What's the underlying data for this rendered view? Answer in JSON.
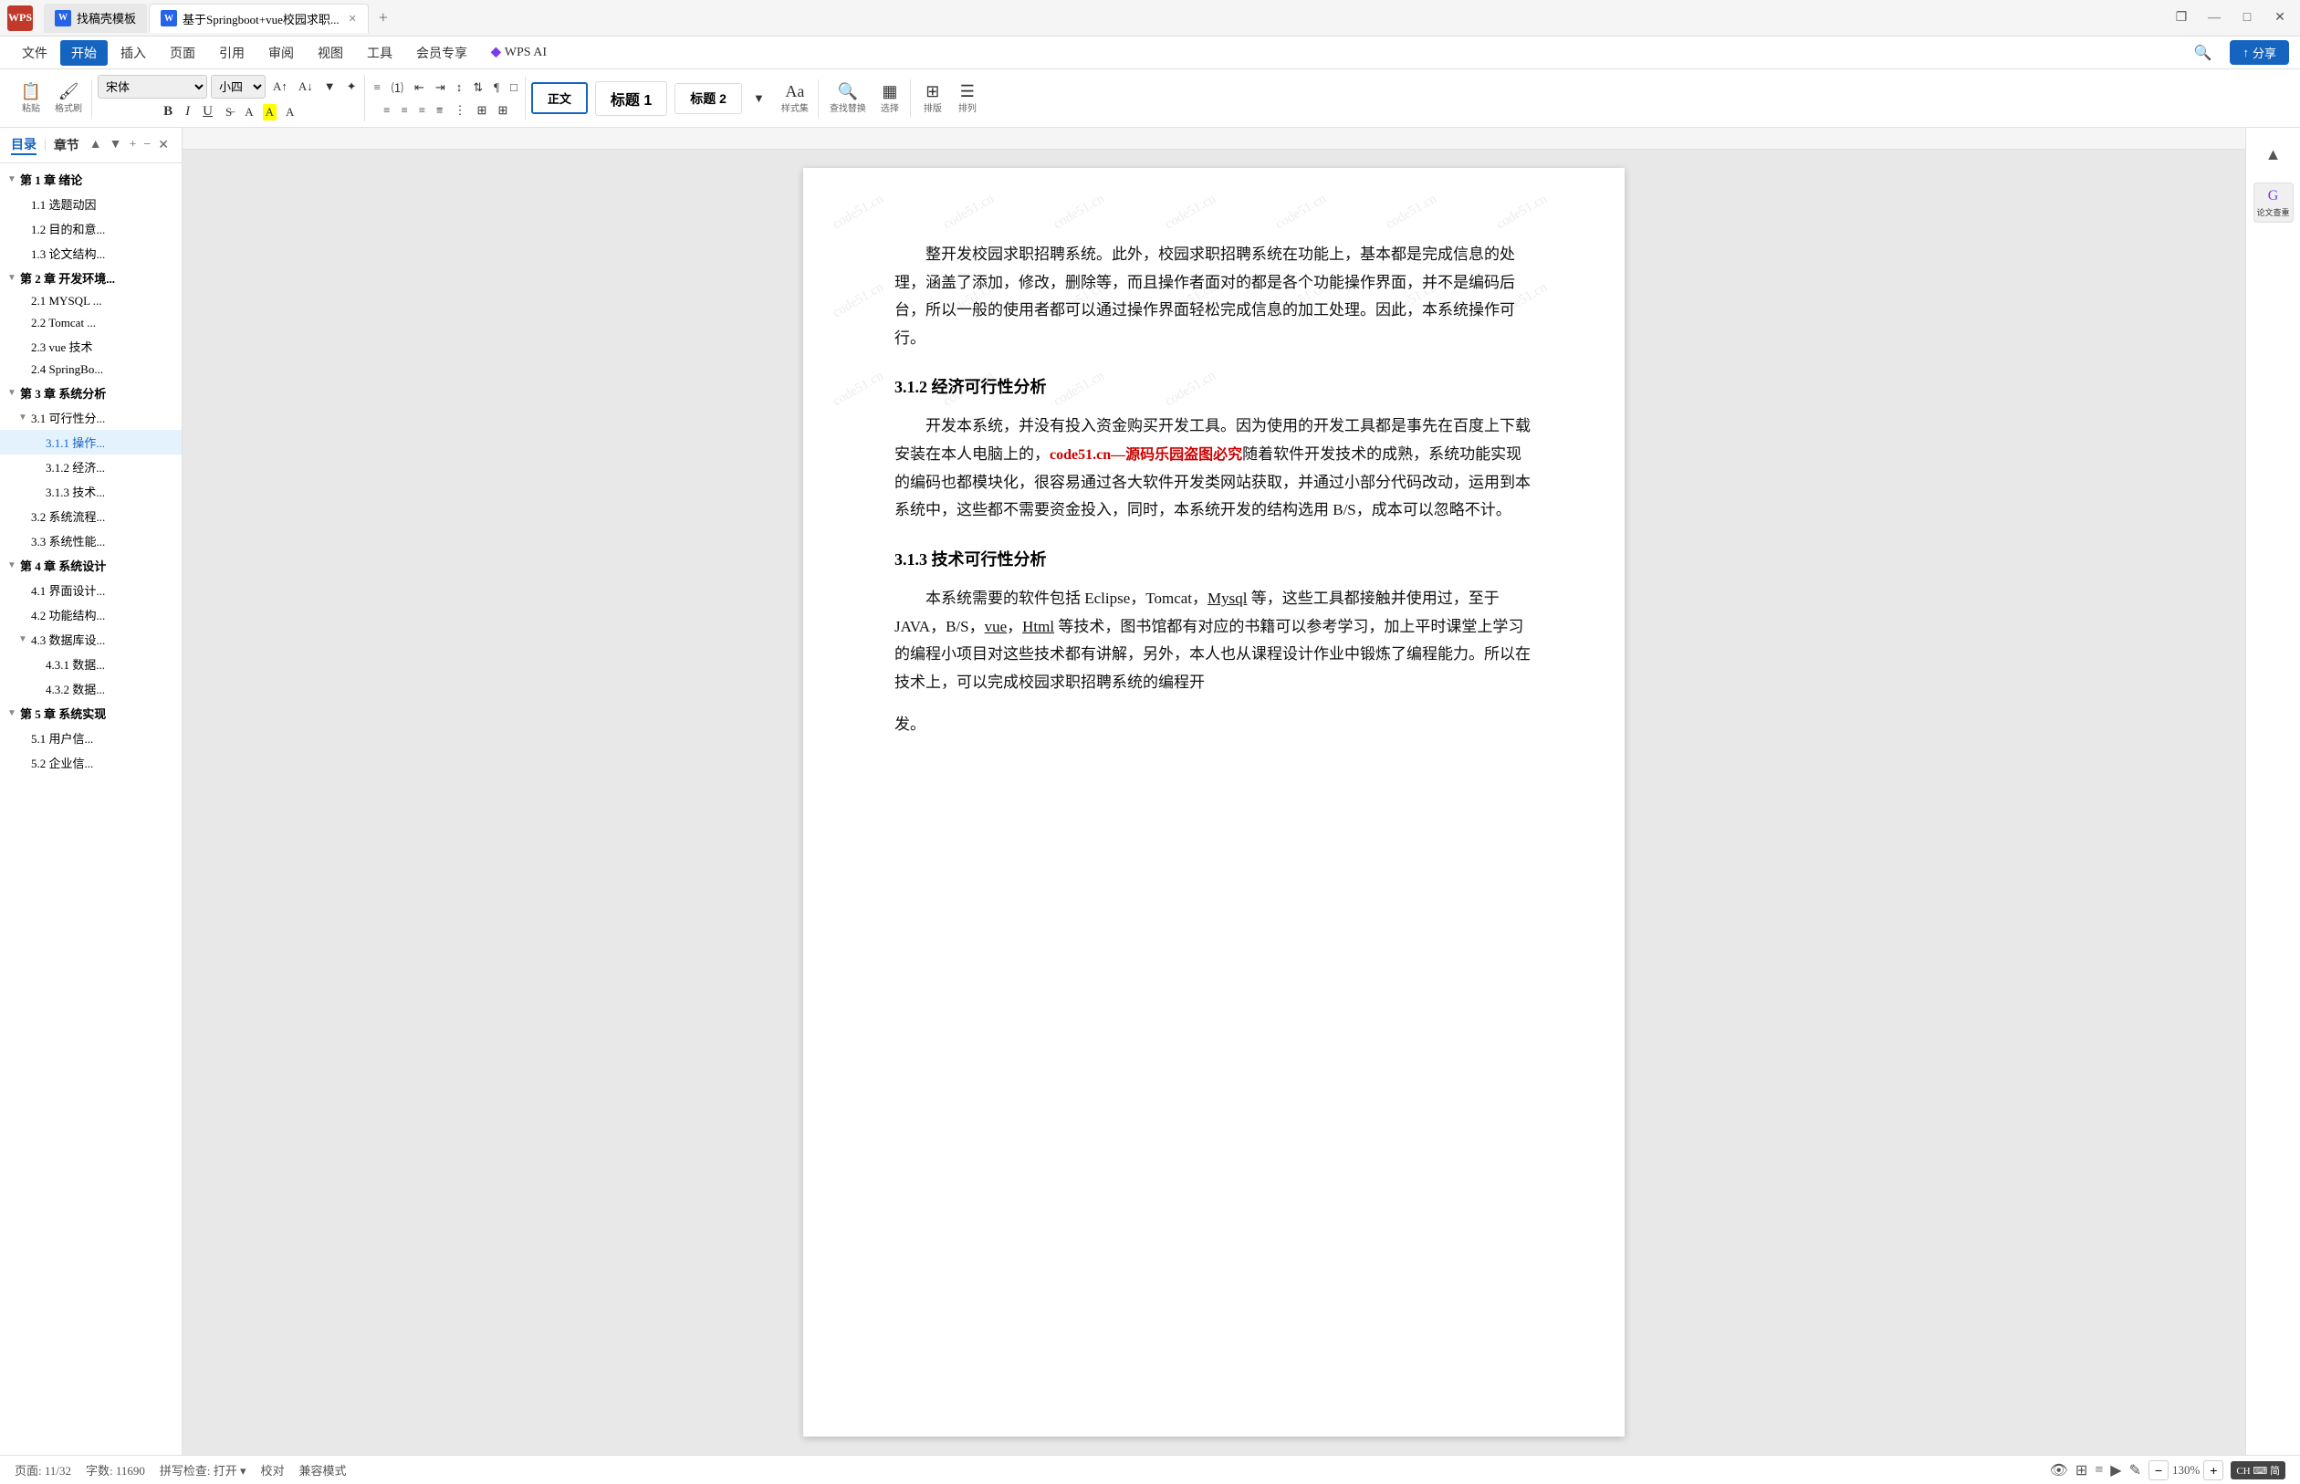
{
  "titlebar": {
    "logo": "WPS",
    "tabs": [
      {
        "label": "找稿壳模板",
        "icon": "W",
        "active": false,
        "closable": false
      },
      {
        "label": "基于Springboot+vue校园求职...",
        "icon": "W",
        "active": true,
        "closable": true
      }
    ],
    "add_tab_label": "+",
    "buttons": {
      "restore": "❐",
      "minimize": "—",
      "maximize": "□",
      "close": "✕"
    }
  },
  "menubar": {
    "items": [
      "文件",
      "开始",
      "插入",
      "页面",
      "引用",
      "审阅",
      "视图",
      "工具",
      "会员专享",
      "WPS AI"
    ],
    "active_item": "开始",
    "search_placeholder": "搜索",
    "share_label": "分享"
  },
  "toolbar": {
    "format_group": {
      "paste_label": "粘贴",
      "clipboard_label": "格式刷"
    },
    "font": "宋体",
    "font_size": "小四",
    "styles": {
      "normal": "正文",
      "h1": "标题 1",
      "h2": "标题 2"
    },
    "find_replace_label": "查找替换",
    "select_label": "选择",
    "layout_label": "排版",
    "row_label": "排列"
  },
  "sidebar": {
    "tab_toc": "目录",
    "tab_chapter": "章节",
    "close_btn": "✕",
    "up_btn": "▲",
    "down_btn": "▼",
    "add_btn": "+",
    "minus_btn": "−",
    "refresh_btn": "↺",
    "tree_items": [
      {
        "label": "第 1 章 绪论",
        "level": 0,
        "expanded": true
      },
      {
        "label": "1.1 选题动因",
        "level": 1
      },
      {
        "label": "1.2 目的和意...",
        "level": 1
      },
      {
        "label": "1.3 论文结构...",
        "level": 1
      },
      {
        "label": "第 2 章 开发环境...",
        "level": 0,
        "expanded": true
      },
      {
        "label": "2.1 MYSQL ...",
        "level": 1
      },
      {
        "label": "2.2 Tomcat ...",
        "level": 1
      },
      {
        "label": "2.3 vue 技术",
        "level": 1
      },
      {
        "label": "2.4 SpringBo...",
        "level": 1
      },
      {
        "label": "第 3 章 系统分析",
        "level": 0,
        "expanded": true
      },
      {
        "label": "3.1 可行性分...",
        "level": 1,
        "expanded": true
      },
      {
        "label": "3.1.1 操作...",
        "level": 2,
        "selected": true
      },
      {
        "label": "3.1.2 经济...",
        "level": 2
      },
      {
        "label": "3.1.3 技术...",
        "level": 2
      },
      {
        "label": "3.2 系统流程...",
        "level": 1
      },
      {
        "label": "3.3 系统性能...",
        "level": 1
      },
      {
        "label": "第 4 章 系统设计",
        "level": 0,
        "expanded": true
      },
      {
        "label": "4.1 界面设计...",
        "level": 1
      },
      {
        "label": "4.2 功能结构...",
        "level": 1
      },
      {
        "label": "4.3 数据库设...",
        "level": 1,
        "expanded": true
      },
      {
        "label": "4.3.1 数据...",
        "level": 2
      },
      {
        "label": "4.3.2 数据...",
        "level": 2
      },
      {
        "label": "第 5 章 系统实现",
        "level": 0,
        "expanded": true
      },
      {
        "label": "5.1 用户信...",
        "level": 1
      },
      {
        "label": "5.2 企业信...",
        "level": 1
      }
    ]
  },
  "document": {
    "paragraphs": [
      {
        "type": "para",
        "text": "整开发校园求职招聘系统。此外，校园求职招聘系统在功能上，基本都是完成信息的处理，涵盖了添加，修改，删除等，而且操作者面对的都是各个功能操作界面，并不是编码后台，所以一般的使用者都可以通过操作界面轻松完成信息的加工处理。因此，本系统操作可行。"
      },
      {
        "type": "heading",
        "num": "3.1.2",
        "title": "经济可行性分析"
      },
      {
        "type": "para",
        "text": "开发本系统，并没有投入资金购买开发工具。因为使用的开发工具都是事先在百度上下载安装在本人电脑上的，随着软件开发技术的成熟，系统功能实现的编码也都模块化，很容易通过各大软件开发类网站获取，并通过小部分代码改动，运用到本系统中，这些都不需要资金投入，同时，本系统开发的结构选用 B/S，成本可以忽略不计。",
        "watermark": "code51.cn—源码乐园盗图必究"
      },
      {
        "type": "heading",
        "num": "3.1.3",
        "title": "技术可行性分析"
      },
      {
        "type": "para",
        "text": "本系统需要的软件包括 Eclipse，Tomcat，Mysql 等，这些工具都接触并使用过，至于 JAVA，B/S，vue，Html 等技术，图书馆都有对应的书籍可以参考学习，加上平时课堂上学习的编程小项目对这些技术都有讲解，另外，本人也从课程设计作业中锻炼了编程能力。所以在技术上，可以完成校园求职招聘系统的编程开发。"
      }
    ],
    "watermark_text": "code51.cn"
  },
  "right_panel": {
    "buttons": [
      {
        "icon": "G",
        "label": "论文查重"
      }
    ]
  },
  "statusbar": {
    "page_info": "页面: 11/32",
    "word_count": "字数: 11690",
    "spellcheck": "拼写检查: 打开 ▾",
    "proofread": "校对",
    "compat_mode": "兼容模式",
    "zoom_level": "130%",
    "ch_badge": "CH ⌨ 简"
  }
}
